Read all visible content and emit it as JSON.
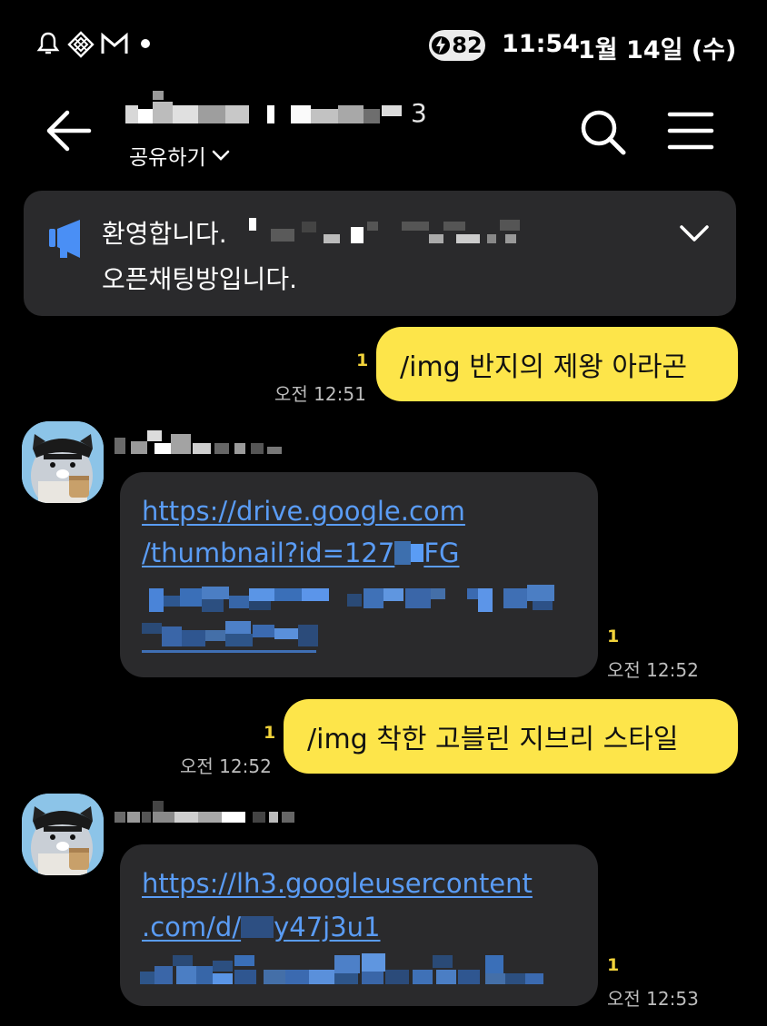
{
  "status_bar": {
    "icons": [
      "bell-icon",
      "app-diamond-icon",
      "gmail-icon",
      "dot-icon"
    ],
    "battery": "82",
    "time": "11:54",
    "date": "1월 14일 (수)"
  },
  "header": {
    "member_count": "3",
    "share_label": "공유하기"
  },
  "notice": {
    "line1": "환영합니다.",
    "line2": "오픈채팅방입니다."
  },
  "messages": [
    {
      "type": "me",
      "text": "/img 반지의 제왕 아라곤",
      "unread": "1",
      "time": "오전 12:51"
    },
    {
      "type": "other",
      "link_line1": "https://drive.google.com",
      "link_line2": "/thumbnail?id=127",
      "link_line2_tail": "FG",
      "unread": "1",
      "time": "오전 12:52"
    },
    {
      "type": "me",
      "text": "/img 착한 고블린 지브리 스타일",
      "unread": "1",
      "time": "오전 12:52"
    },
    {
      "type": "other",
      "link_line1": "https://lh3.googleusercontent",
      "link_line2": ".com/d/",
      "link_line2_tail": "y47j3u1",
      "unread": "1",
      "time": "오전 12:53"
    }
  ],
  "colors": {
    "background": "#000000",
    "my_bubble": "#fde54a",
    "other_bubble": "#2a2a2c",
    "link": "#5a9cf5",
    "unread": "#f2d33b"
  }
}
